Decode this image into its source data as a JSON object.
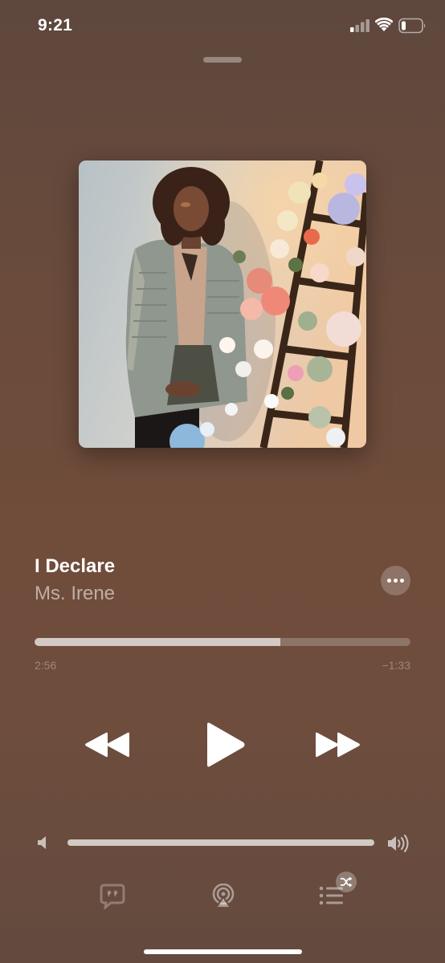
{
  "status_bar": {
    "time": "9:21",
    "icons": [
      "cellular-signal-icon",
      "wifi-icon",
      "battery-icon"
    ]
  },
  "now_playing": {
    "artwork_description": "album-artwork",
    "title": "I Declare",
    "artist": "Ms. Irene"
  },
  "playback": {
    "elapsed": "2:56",
    "remaining": "−1:33",
    "progress_fraction": 0.654
  },
  "volume": {
    "level_fraction": 1.0
  },
  "controls": {
    "buttons": [
      "rewind-icon",
      "play-icon",
      "fast-forward-icon",
      "more-icon"
    ],
    "bottom_bar": [
      "lyrics-icon",
      "airplay-icon",
      "queue-icon",
      "shuffle-icon"
    ]
  },
  "colors": {
    "background_top": "#5e473d",
    "background_mid": "#704c3a",
    "text_primary": "#ffffff"
  }
}
